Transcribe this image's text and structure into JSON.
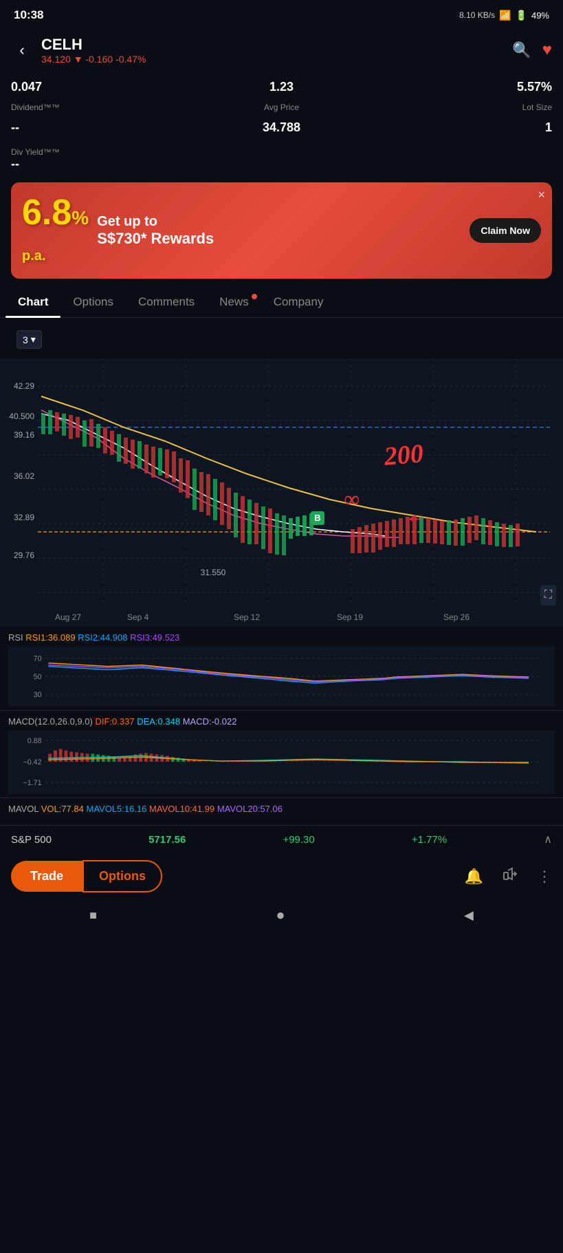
{
  "statusBar": {
    "time": "10:38",
    "network": "8.10 KB/s",
    "battery": "49%",
    "signal": "5G"
  },
  "header": {
    "ticker": "CELH",
    "price": "34.120",
    "change": "-0.160",
    "changePct": "-0.47%",
    "backLabel": "‹",
    "searchLabel": "🔍",
    "favoriteLabel": "♥"
  },
  "stats": {
    "eps": "0.047",
    "epsLabel": "",
    "pe": "1.23",
    "peLabel": "",
    "lotSize": "5.57%",
    "lotSizeLabel": "Lot Size",
    "dividendLabel": "Dividend™™",
    "dividendValue": "--",
    "avgPriceLabel": "Avg Price",
    "avgPrice": "34.788",
    "lotSizeNum": "1",
    "divYieldLabel": "Div Yield™™",
    "divYieldValue": "--"
  },
  "banner": {
    "bigText": "6.8%p.a.",
    "title": "Get up to",
    "subtitle": "S$730* Rewards",
    "ctaLabel": "Claim Now",
    "closeLabel": "×"
  },
  "tabs": [
    {
      "id": "chart",
      "label": "Chart",
      "active": true,
      "hasDot": false
    },
    {
      "id": "options",
      "label": "Options",
      "active": false,
      "hasDot": false
    },
    {
      "id": "comments",
      "label": "Comments",
      "active": false,
      "hasDot": false
    },
    {
      "id": "news",
      "label": "News",
      "active": false,
      "hasDot": true
    },
    {
      "id": "company",
      "label": "Company",
      "active": false,
      "hasDot": false
    }
  ],
  "chart": {
    "periodLabel": "3",
    "priceLabels": [
      "42.29",
      "40.500",
      "39.16",
      "36.02",
      "32.89",
      "29.76"
    ],
    "dateLabels": [
      "Aug 27",
      "Sep 4",
      "Sep 12",
      "Sep 19",
      "Sep 26"
    ],
    "annotation1": "200",
    "annotation2": "∞",
    "annotation3": "←",
    "markerB": "B",
    "price31": "31.550",
    "fullscreenIcon": "⛶"
  },
  "rsi": {
    "label": "RSI",
    "rsi1Label": "RSI1:36.089",
    "rsi2Label": "RSI2:44.908",
    "rsi3Label": "RSI3:49.523",
    "levels": [
      "70",
      "50",
      "30"
    ]
  },
  "macd": {
    "label": "MACD(12.0,26.0,9.0)",
    "dif": "DIF:0.337",
    "dea": "DEA:0.348",
    "macd": "MACD:-0.022",
    "levels": [
      "0.88",
      "−0.42",
      "−1.71"
    ]
  },
  "mavol": {
    "label": "MAVOL",
    "vol": "VOL:77.84",
    "mavol5": "MAVOL5:16.16",
    "mavol10": "MAVOL10:41.99",
    "mavol20": "MAVOL20:57.06"
  },
  "bottomTicker": {
    "name": "S&P 500",
    "price": "5717.56",
    "change": "+99.30",
    "pct": "+1.77%",
    "chevron": "∧"
  },
  "bottomNav": {
    "tradeLabel": "Trade",
    "optionsLabel": "Options",
    "bellIcon": "🔔",
    "shareIcon": "↗",
    "moreIcon": "⋮"
  },
  "systemNav": {
    "squareIcon": "■",
    "circleIcon": "●",
    "backIcon": "◀"
  }
}
